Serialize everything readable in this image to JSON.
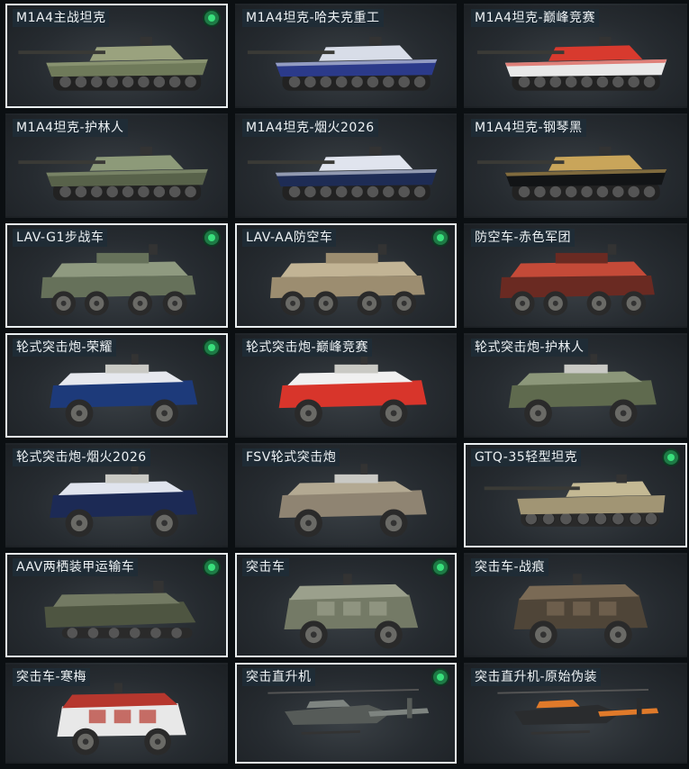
{
  "vehicles": [
    {
      "name": "M1A4主战坦克",
      "type": "tank",
      "body": "#6f7a5a",
      "accent": "#9aa27e",
      "selected": true,
      "owned": true
    },
    {
      "name": "M1A4坦克-哈夫克重工",
      "type": "tank",
      "body": "#2b3a8a",
      "accent": "#d8dde8",
      "selected": false,
      "owned": false
    },
    {
      "name": "M1A4坦克-巅峰竞赛",
      "type": "tank",
      "body": "#e9e9e9",
      "accent": "#d83a2e",
      "selected": false,
      "owned": false
    },
    {
      "name": "M1A4坦克-护林人",
      "type": "tank",
      "body": "#58624a",
      "accent": "#8d9a79",
      "selected": false,
      "owned": false
    },
    {
      "name": "M1A4坦克-烟火2026",
      "type": "tank",
      "body": "#1e2c55",
      "accent": "#e0e4ee",
      "selected": false,
      "owned": false
    },
    {
      "name": "M1A4坦克-钢琴黑",
      "type": "tank",
      "body": "#121416",
      "accent": "#c9a55a",
      "selected": false,
      "owned": false
    },
    {
      "name": "LAV-G1步战车",
      "type": "apc",
      "body": "#66715a",
      "accent": "#8f9a80",
      "selected": true,
      "owned": true
    },
    {
      "name": "LAV-AA防空车",
      "type": "apc",
      "body": "#9c8d70",
      "accent": "#c2b495",
      "selected": true,
      "owned": true
    },
    {
      "name": "防空车-赤色军团",
      "type": "apc",
      "body": "#6a2a22",
      "accent": "#c44a38",
      "selected": false,
      "owned": false
    },
    {
      "name": "轮式突击炮-荣耀",
      "type": "wheeled",
      "body": "#1d3a7a",
      "accent": "#e6e8ee",
      "selected": true,
      "owned": true
    },
    {
      "name": "轮式突击炮-巅峰竞赛",
      "type": "wheeled",
      "body": "#d8352b",
      "accent": "#f0f0f0",
      "selected": false,
      "owned": false
    },
    {
      "name": "轮式突击炮-护林人",
      "type": "wheeled",
      "body": "#5f6a4e",
      "accent": "#8c977a",
      "selected": false,
      "owned": false
    },
    {
      "name": "轮式突击炮-烟火2026",
      "type": "wheeled",
      "body": "#1c2a55",
      "accent": "#e0e4ee",
      "selected": false,
      "owned": false
    },
    {
      "name": "FSV轮式突击炮",
      "type": "wheeled",
      "body": "#8f8472",
      "accent": "#b3a992",
      "selected": false,
      "owned": false
    },
    {
      "name": "GTQ-35轻型坦克",
      "type": "light-tank",
      "body": "#a19574",
      "accent": "#c4b994",
      "selected": true,
      "owned": true
    },
    {
      "name": "AAV两栖装甲运输车",
      "type": "amphibious",
      "body": "#4e5541",
      "accent": "#737a63",
      "selected": true,
      "owned": true
    },
    {
      "name": "突击车",
      "type": "truck",
      "body": "#747a66",
      "accent": "#9ba08c",
      "selected": true,
      "owned": true
    },
    {
      "name": "突击车-战痕",
      "type": "truck",
      "body": "#4f4538",
      "accent": "#7a6a55",
      "selected": false,
      "owned": false
    },
    {
      "name": "突击车-寒梅",
      "type": "truck",
      "body": "#e8e8e8",
      "accent": "#b6372e",
      "selected": false,
      "owned": false
    },
    {
      "name": "突击直升机",
      "type": "heli",
      "body": "#565b58",
      "accent": "#7e8480",
      "selected": true,
      "owned": true
    },
    {
      "name": "突击直升机-原始伪装",
      "type": "heli",
      "body": "#2a2c2e",
      "accent": "#e07a2a",
      "selected": false,
      "owned": false
    }
  ]
}
